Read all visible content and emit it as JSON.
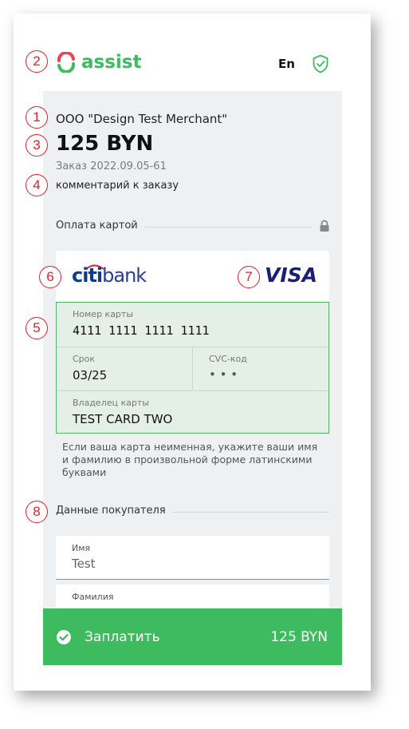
{
  "header": {
    "logo_text": "assist",
    "language": "En"
  },
  "order_info": {
    "merchant": "ООО \"Design Test Merchant\"",
    "amount": "125  BYN",
    "order_label": "Заказ",
    "order_number": "2022.09.05-61",
    "comment": "комментарий к заказу"
  },
  "card_section": {
    "title": "Оплата картой",
    "bank_logo_part1": "citi",
    "bank_logo_part2": "bank",
    "payment_system": "VISA",
    "card_number_label": "Номер карты",
    "card_number_value": "4111  1111  1111  1111",
    "expiry_label": "Срок",
    "expiry_value": "03/25",
    "cvc_label": "CVC-код",
    "cvc_value": "• • •",
    "holder_label": "Владелец карты",
    "holder_value": "TEST CARD TWO",
    "hint": "Если ваша карта неименная, укажите ваши имя и фамилию в произвольной форме латинскими буквами"
  },
  "buyer_section": {
    "title": "Данные покупателя",
    "first_name_label": "Имя",
    "first_name_value": "Test",
    "last_name_label": "Фамилия",
    "last_name_value": ""
  },
  "pay_button": {
    "label": "Заплатить",
    "amount": "125 BYN"
  },
  "callouts": [
    "1",
    "2",
    "3",
    "4",
    "5",
    "6",
    "7",
    "8"
  ],
  "colors": {
    "accent_green": "#3dbb5e",
    "card_fields_bg": "#e4efe5",
    "callout_red": "#e0202a",
    "citi_blue": "#0f3b8c",
    "visa_blue": "#1a1f71"
  }
}
